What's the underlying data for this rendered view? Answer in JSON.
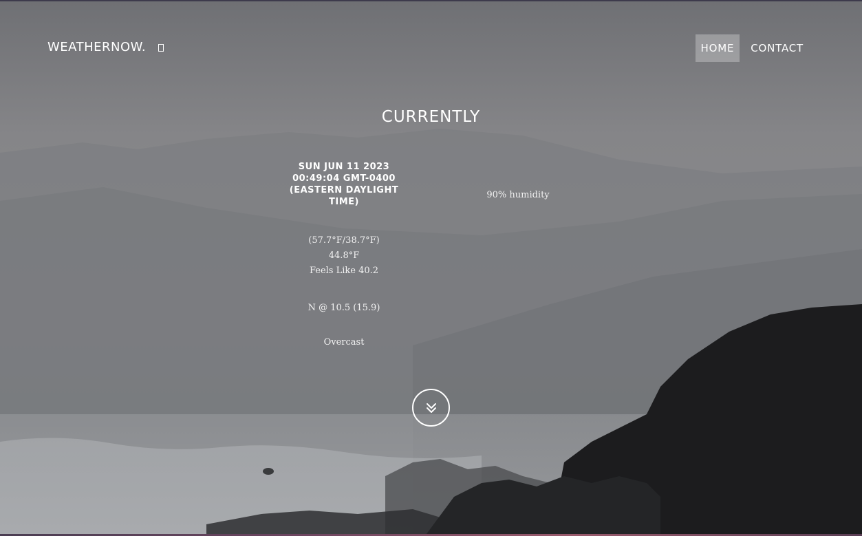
{
  "brand": {
    "name": "WEATHERNOW.",
    "icon": "small-square-icon"
  },
  "nav": {
    "home": "HOME",
    "contact": "CONTACT"
  },
  "current": {
    "title": "CURRENTLY",
    "datetime": "SUN JUN 11 2023 00:49:04 GMT-0400 (EASTERN DAYLIGHT TIME)",
    "high_low": "(57.7°F/38.7°F)",
    "temperature": "44.8°F",
    "feels_like": "Feels Like 40.2",
    "wind": "N @ 10.5 (15.9)",
    "condition": "Overcast",
    "humidity": "90% humidity"
  },
  "scroll_button": {
    "icon": "double-chevron-down-icon"
  },
  "colors": {
    "nav_active_bg": "rgba(255,255,255,0.28)",
    "text": "#ffffff",
    "bg_sky": "#7d7e82",
    "cliff": "#1c1c1e"
  }
}
